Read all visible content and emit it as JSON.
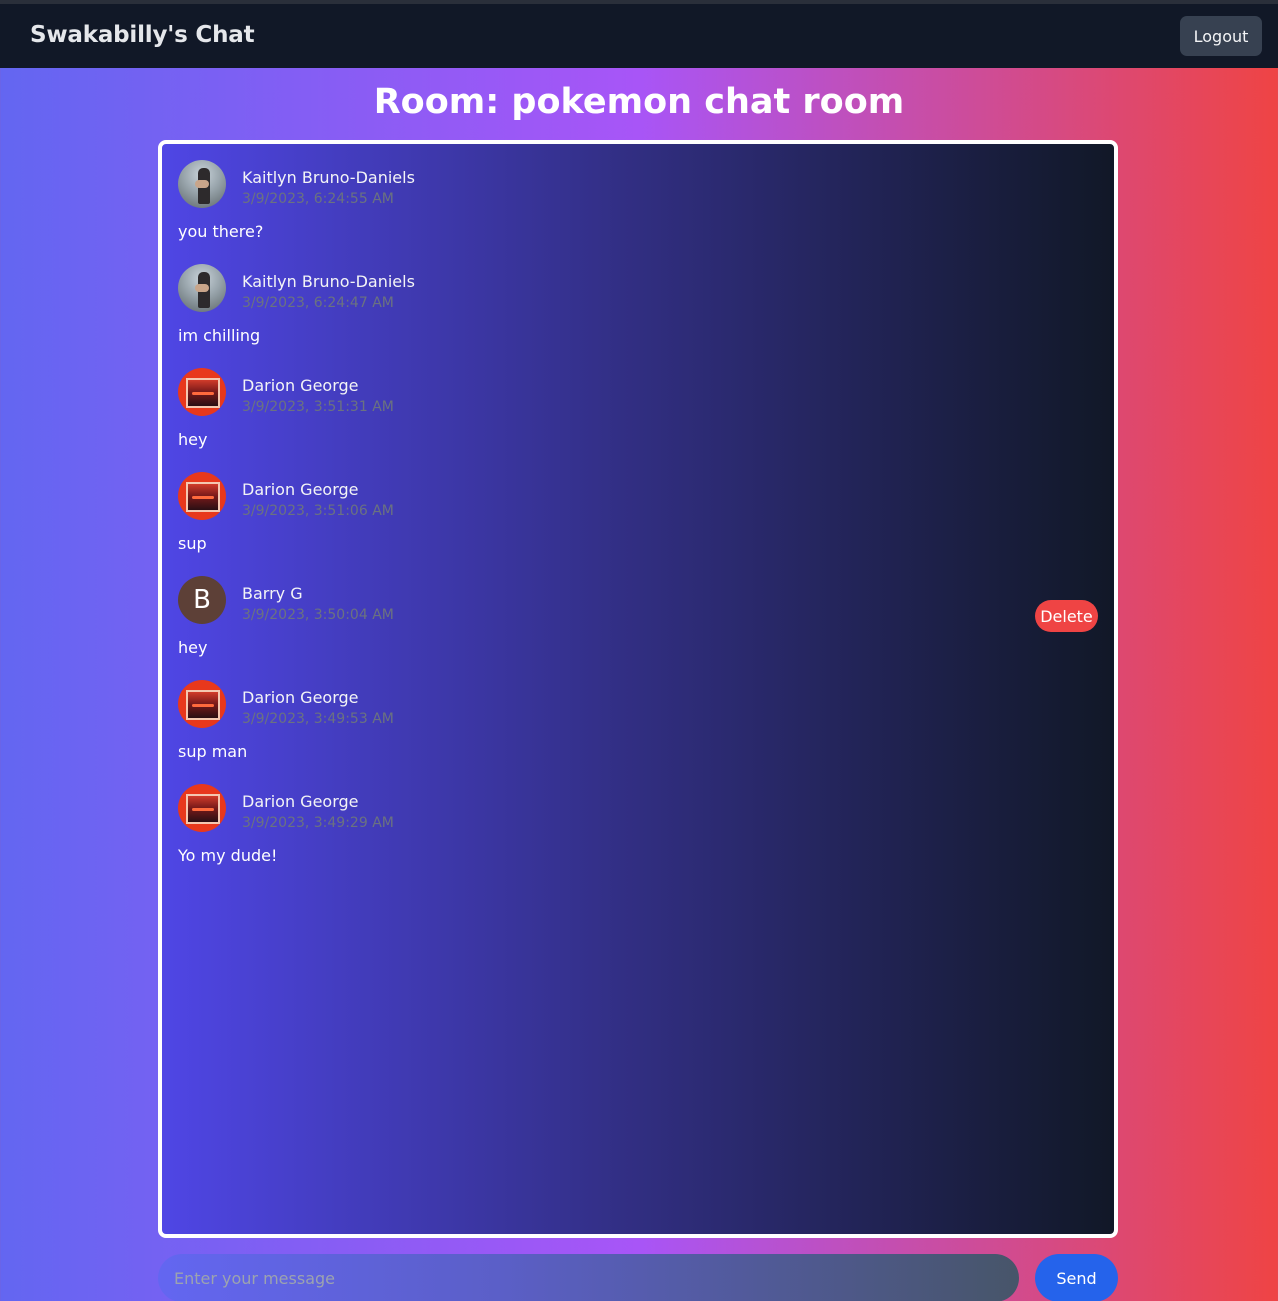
{
  "header": {
    "brand": "Swakabilly's Chat",
    "logout_label": "Logout"
  },
  "room": {
    "title": "Room: pokemon chat room"
  },
  "messages": [
    {
      "user": "Kaitlyn Bruno-Daniels",
      "time": "3/9/2023, 6:24:55 AM",
      "text": "you there?",
      "avatar": "photo"
    },
    {
      "user": "Kaitlyn Bruno-Daniels",
      "time": "3/9/2023, 6:24:47 AM",
      "text": "im chilling",
      "avatar": "photo"
    },
    {
      "user": "Darion George",
      "time": "3/9/2023, 3:51:31 AM",
      "text": "hey",
      "avatar": "lava"
    },
    {
      "user": "Darion George",
      "time": "3/9/2023, 3:51:06 AM",
      "text": "sup",
      "avatar": "lava"
    },
    {
      "user": "Barry G",
      "time": "3/9/2023, 3:50:04 AM",
      "text": "hey",
      "avatar": "letter",
      "avatar_letter": "B",
      "delete_label": "Delete"
    },
    {
      "user": "Darion George",
      "time": "3/9/2023, 3:49:53 AM",
      "text": "sup man",
      "avatar": "lava"
    },
    {
      "user": "Darion George",
      "time": "3/9/2023, 3:49:29 AM",
      "text": "Yo my dude!",
      "avatar": "lava"
    }
  ],
  "composer": {
    "placeholder": "Enter your message",
    "value": "",
    "send_label": "Send"
  },
  "colors": {
    "navbar": "#111827",
    "delete": "#ef4444",
    "send": "#2563eb",
    "barry_avatar": "#5d4037"
  }
}
